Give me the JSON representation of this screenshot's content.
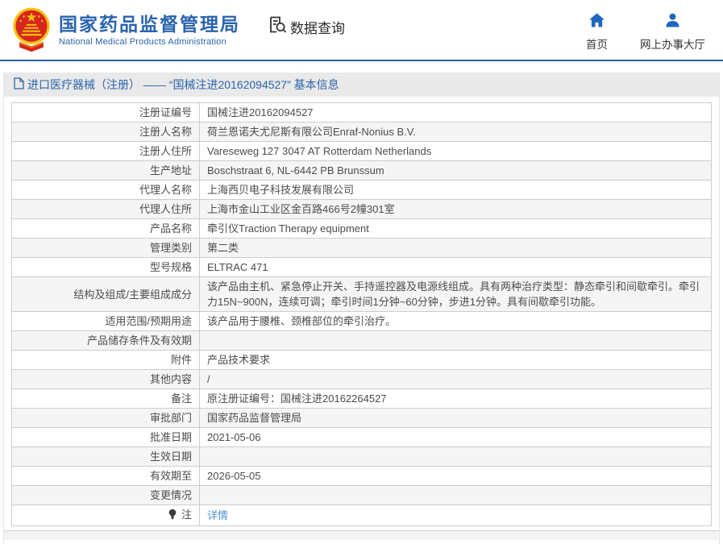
{
  "header": {
    "title": "国家药品监督管理局",
    "subtitle": "National Medical Products Administration",
    "data_query_label": "数据查询",
    "home_label": "首页",
    "hall_label": "网上办事大厅"
  },
  "breadcrumb": {
    "text": "进口医疗器械（注册） —— “国械注进20162094527” 基本信息"
  },
  "table": {
    "rows": [
      {
        "label": "注册证编号",
        "value": "国械注进20162094527"
      },
      {
        "label": "注册人名称",
        "value": "荷兰恩诺夫尤尼斯有限公司Enraf-Nonius B.V."
      },
      {
        "label": "注册人住所",
        "value": "Vareseweg 127 3047 AT Rotterdam Netherlands"
      },
      {
        "label": "生产地址",
        "value": "Boschstraat 6, NL-6442 PB Brunssum"
      },
      {
        "label": "代理人名称",
        "value": "上海西贝电子科技发展有限公司"
      },
      {
        "label": "代理人住所",
        "value": "上海市金山工业区金百路466号2幢301室"
      },
      {
        "label": "产品名称",
        "value": "牵引仪Traction Therapy equipment"
      },
      {
        "label": "管理类别",
        "value": "第二类"
      },
      {
        "label": "型号规格",
        "value": "ELTRAC 471"
      },
      {
        "label": "结构及组成/主要组成成分",
        "value": "该产品由主机、紧急停止开关、手持遥控器及电源线组成。具有两种治疗类型：静态牵引和间歇牵引。牵引力15N~900N，连续可调；牵引时间1分钟~60分钟，步进1分钟。具有间歇牵引功能。"
      },
      {
        "label": "适用范围/预期用途",
        "value": "该产品用于腰椎、颈椎部位的牵引治疗。"
      },
      {
        "label": "产品储存条件及有效期",
        "value": ""
      },
      {
        "label": "附件",
        "value": "产品技术要求"
      },
      {
        "label": "其他内容",
        "value": "/"
      },
      {
        "label": "备注",
        "value": "原注册证编号：国械注进20162264527"
      },
      {
        "label": "审批部门",
        "value": "国家药品监督管理局"
      },
      {
        "label": "批准日期",
        "value": "2021-05-06"
      },
      {
        "label": "生效日期",
        "value": ""
      },
      {
        "label": "有效期至",
        "value": "2026-05-05"
      },
      {
        "label": "变更情况",
        "value": ""
      },
      {
        "label": "注",
        "value": "详情",
        "value_is_link": true,
        "label_icon": "bulb-icon"
      }
    ]
  },
  "colors": {
    "accent-blue": "#2a64ad",
    "link-blue": "#4b94d6",
    "icon-blue": "#1f66c1",
    "breadcrumb-bg": "#e9e9e9",
    "row-alt-bg": "#f5f5f5",
    "table-border": "#cccccc",
    "text-dark": "#4c4c4c",
    "emblem-red": "#d7261d",
    "emblem-gold": "#f2c011"
  }
}
